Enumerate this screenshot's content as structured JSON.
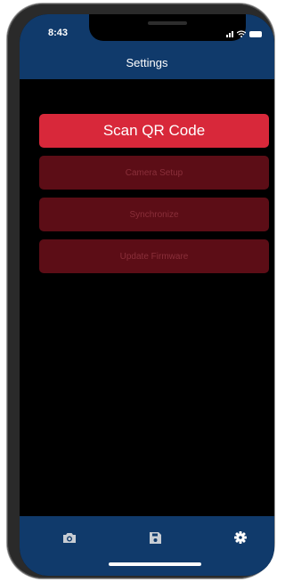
{
  "status_bar": {
    "time": "8:43",
    "icons": [
      "signal-icon",
      "wifi-icon",
      "battery-icon"
    ]
  },
  "header": {
    "title": "Settings",
    "background_color": "#103a6b"
  },
  "menu": {
    "items": [
      {
        "label": "Scan QR Code",
        "state": "enabled",
        "color": "#d8283a"
      },
      {
        "label": "Camera Setup",
        "state": "disabled",
        "color": "#5c0d16"
      },
      {
        "label": "Synchronize",
        "state": "disabled",
        "color": "#5c0d16"
      },
      {
        "label": "Update Firmware",
        "state": "disabled",
        "color": "#5c0d16"
      }
    ]
  },
  "tab_bar": {
    "tabs": [
      {
        "icon": "camera-icon",
        "selected": false
      },
      {
        "icon": "save-icon",
        "selected": false
      },
      {
        "icon": "gear-icon",
        "selected": true
      }
    ]
  }
}
